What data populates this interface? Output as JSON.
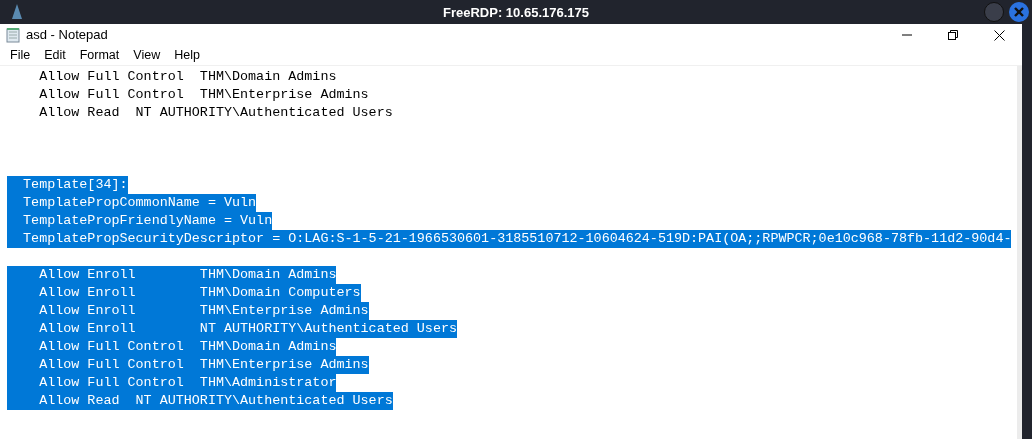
{
  "rdp_bar": {
    "title": "FreeRDP: 10.65.176.175"
  },
  "window": {
    "title": "asd - Notepad"
  },
  "menu": [
    "File",
    "Edit",
    "Format",
    "View",
    "Help"
  ],
  "lines": [
    {
      "kind": "text",
      "text": "    Allow Full Control  THM\\Domain Admins",
      "selected": false
    },
    {
      "kind": "text",
      "text": "    Allow Full Control  THM\\Enterprise Admins",
      "selected": false
    },
    {
      "kind": "text",
      "text": "    Allow Read  NT AUTHORITY\\Authenticated Users",
      "selected": false
    },
    {
      "kind": "blank"
    },
    {
      "kind": "blank"
    },
    {
      "kind": "blank"
    },
    {
      "kind": "text",
      "text": "  Template[34]:",
      "selected": true
    },
    {
      "kind": "text",
      "text": "  TemplatePropCommonName = Vuln",
      "selected": true
    },
    {
      "kind": "text",
      "text": "  TemplatePropFriendlyName = Vuln",
      "selected": true
    },
    {
      "kind": "text",
      "text": "  TemplatePropSecurityDescriptor = O:LAG:S-1-5-21-1966530601-3185510712-10604624-519D:PAI(OA;;RPWPCR;0e10c968-78fb-11d2-90d4-",
      "selected": true
    },
    {
      "kind": "blank"
    },
    {
      "kind": "text",
      "text": "    Allow Enroll        THM\\Domain Admins",
      "selected": true
    },
    {
      "kind": "text",
      "text": "    Allow Enroll        THM\\Domain Computers",
      "selected": true
    },
    {
      "kind": "text",
      "text": "    Allow Enroll        THM\\Enterprise Admins",
      "selected": true
    },
    {
      "kind": "text",
      "text": "    Allow Enroll        NT AUTHORITY\\Authenticated Users",
      "selected": true
    },
    {
      "kind": "text",
      "text": "    Allow Full Control  THM\\Domain Admins",
      "selected": true
    },
    {
      "kind": "text",
      "text": "    Allow Full Control  THM\\Enterprise Admins",
      "selected": true
    },
    {
      "kind": "text",
      "text": "    Allow Full Control  THM\\Administrator",
      "selected": true
    },
    {
      "kind": "text",
      "text": "    Allow Read  NT AUTHORITY\\Authenticated Users",
      "selected": true
    }
  ]
}
